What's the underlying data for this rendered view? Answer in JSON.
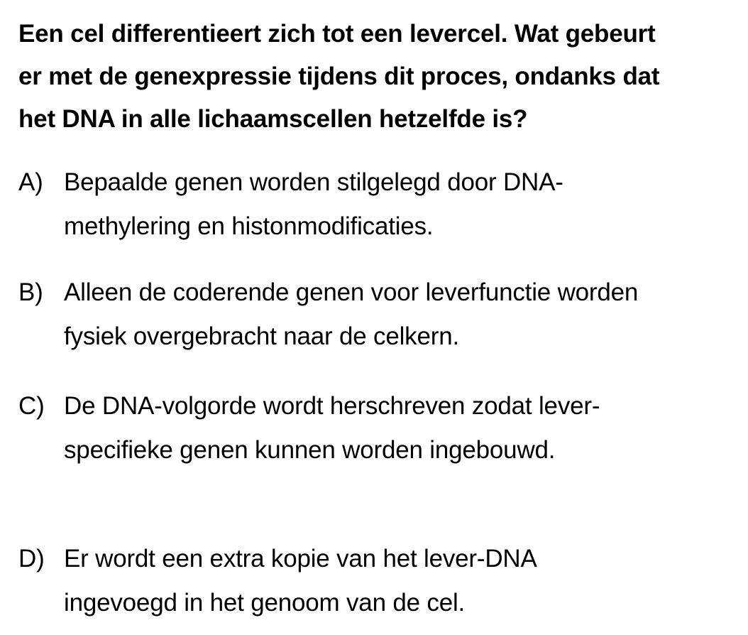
{
  "question": {
    "lines": [
      "Een cel differentieert zich tot een levercel. Wat gebeurt",
      "er met de genexpressie tijdens dit proces, ondanks dat",
      "het DNA in alle lichaamscellen hetzelfde is?"
    ]
  },
  "options": [
    {
      "letter": "A)",
      "lines": [
        "Bepaalde genen worden stilgelegd door DNA-",
        "methylering en histonmodificaties."
      ]
    },
    {
      "letter": "B)",
      "lines": [
        "Alleen de coderende genen voor leverfunctie worden",
        "fysiek overgebracht naar de celkern."
      ]
    },
    {
      "letter": "C)",
      "lines": [
        "De DNA-volgorde wordt herschreven zodat lever-",
        "specifieke genen kunnen worden ingebouwd."
      ]
    },
    {
      "letter": "D)",
      "lines": [
        "Er wordt een extra kopie van het lever-DNA",
        "ingevoegd in het genoom van de cel."
      ]
    }
  ]
}
